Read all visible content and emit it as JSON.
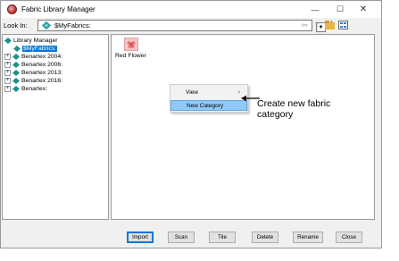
{
  "window": {
    "title": "Fabric Library Manager",
    "controls": {
      "minimize": "—",
      "maximize": "☐",
      "close": "✕"
    }
  },
  "lookin": {
    "label": "Look In:",
    "value": "$MyFabrics:"
  },
  "tree": {
    "root": "Library Manager",
    "selected": "$MyFabrics:",
    "items": [
      "Benartex 2004:",
      "Benartex 2006:",
      "Benartex 2013:",
      "Benartex 2016:",
      "Benartex:"
    ]
  },
  "content": {
    "items": [
      {
        "label": "Red Flower",
        "icon": "fabric-swatch-icon"
      }
    ]
  },
  "context_menu": {
    "items": [
      {
        "label": "View",
        "submenu": true
      },
      {
        "label": "New Category",
        "highlighted": true
      }
    ]
  },
  "annotation": {
    "line1": "Create new fabric",
    "line2": "category"
  },
  "buttons": {
    "import": "Import",
    "scan": "Scan",
    "tile": "Tile",
    "delete": "Delete",
    "rename": "Rename",
    "close": "Close"
  },
  "colors": {
    "selection": "#0078d7",
    "menu_highlight": "#91c9f7",
    "folder_teal": "#1c8f8f"
  }
}
